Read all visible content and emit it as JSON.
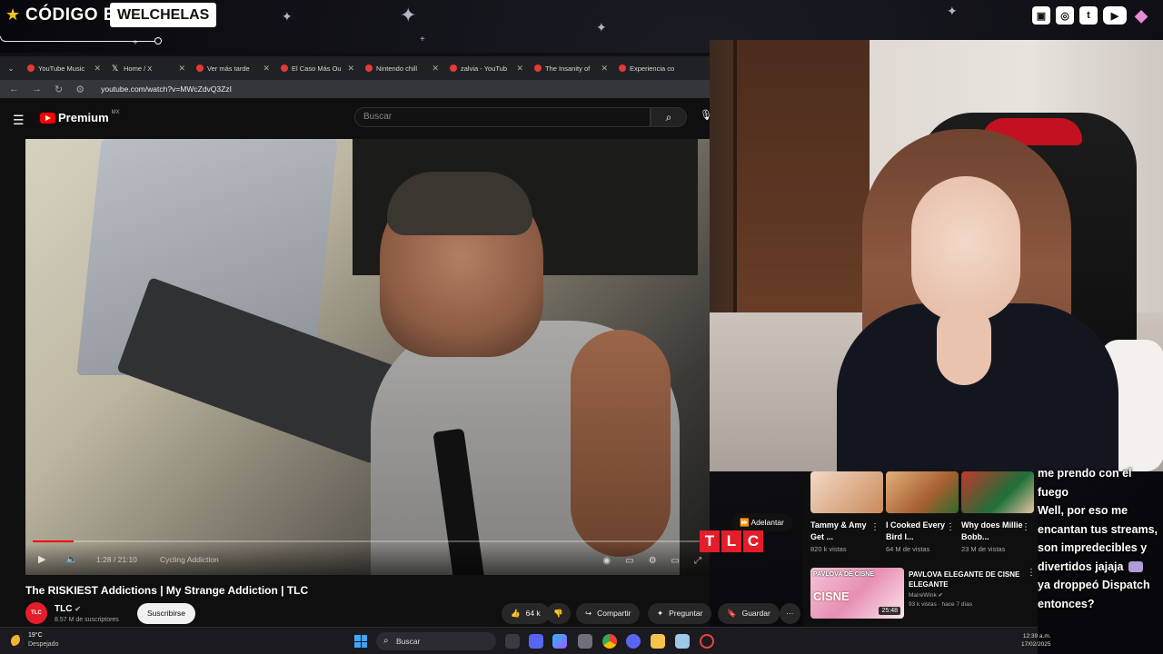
{
  "overlay": {
    "code_label": "CÓDIGO EPIC",
    "channel_name": "WELCHELAS",
    "social_icons": [
      "twitch-icon",
      "instagram-icon",
      "twitter-icon",
      "youtube-icon",
      "gem-icon"
    ]
  },
  "browser": {
    "tabs": [
      {
        "title": "YouTube Music",
        "icon": "youtube-music-icon"
      },
      {
        "title": "Home / X",
        "icon": "x-icon"
      },
      {
        "title": "Ver más tarde",
        "icon": "youtube-icon"
      },
      {
        "title": "El Caso Más Ou",
        "icon": "youtube-icon"
      },
      {
        "title": "Nintendo chill",
        "icon": "youtube-icon"
      },
      {
        "title": "zalvia - YouTub",
        "icon": "youtube-icon"
      },
      {
        "title": "The Insanity of",
        "icon": "youtube-icon"
      },
      {
        "title": "Experiencia co",
        "icon": "youtube-icon"
      }
    ],
    "url": "youtube.com/watch?v=MWcZdvQ3ZzI"
  },
  "youtube": {
    "logo_text": "Premium",
    "logo_region": "MX",
    "search_placeholder": "Buscar"
  },
  "video": {
    "progress": 0.06,
    "time": "1:28 / 21:10",
    "chapter": "Cycling Addiction",
    "skip_label": "Adelantar",
    "tlc_letters": [
      "T",
      "L",
      "C"
    ],
    "title": "The RISKIEST Addictions | My Strange Addiction | TLC",
    "channel": "TLC",
    "channel_avatar": "TLC",
    "subscribers": "8.57 M de suscriptores",
    "subscribe_label": "Suscribirse",
    "likes": "64 k",
    "share_label": "Compartir",
    "ask_label": "Preguntar",
    "save_label": "Guardar"
  },
  "recommendations": {
    "row1": [
      {
        "title": "Tammy & Amy Get ...",
        "meta": "820 k vistas"
      },
      {
        "title": "I Cooked Every Bird I...",
        "meta": "64 M de vistas"
      },
      {
        "title": "Why does Millie Bobb...",
        "meta": "23 M de vistas"
      }
    ],
    "row2": {
      "thumb_label": "PAVLOVA DE CISNE",
      "thumb_big": "CISNE",
      "duration": "25:48",
      "title": "PAVLOVA ELEGANTE DE CISNE ELEGANTE",
      "channel": "MaireWink",
      "meta": "93 k vistas · hace 7 días"
    }
  },
  "chat": {
    "messages": [
      "me prendo con el fuego",
      "Well, por eso me encantan tus streams, son impredecibles y divertidos jajaja",
      "ya droppeó Dispatch entonces?"
    ]
  },
  "taskbar": {
    "temperature": "19°C",
    "weather": "Despejado",
    "search_label": "Buscar",
    "time": "12:39 a.m.",
    "date": "17/02/2025"
  }
}
